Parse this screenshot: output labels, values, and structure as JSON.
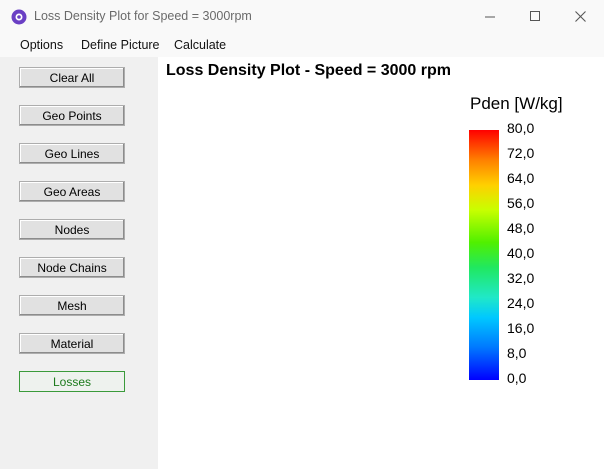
{
  "window": {
    "title": "Loss Density Plot for Speed = 3000rpm"
  },
  "menu": {
    "items": [
      "Options",
      "Define Picture",
      "Calculate"
    ]
  },
  "sidebar": {
    "buttons": [
      "Clear All",
      "Geo Points",
      "Geo Lines",
      "Geo Areas",
      "Nodes",
      "Node Chains",
      "Mesh",
      "Material",
      "Losses"
    ],
    "active": "Losses"
  },
  "plot": {
    "title": "Loss Density Plot - Speed = 3000 rpm"
  },
  "legend": {
    "title": "Pden [W/kg]",
    "ticks": [
      "80,0",
      "72,0",
      "64,0",
      "56,0",
      "48,0",
      "40,0",
      "32,0",
      "24,0",
      "16,0",
      "8,0",
      "0,0"
    ]
  },
  "colors": {
    "active_button": "#3a9a3a",
    "stator_yoke": "#00c8e0",
    "teeth": "#b0ff20",
    "slots": "#0018e0",
    "rotor": "#0000d8"
  }
}
